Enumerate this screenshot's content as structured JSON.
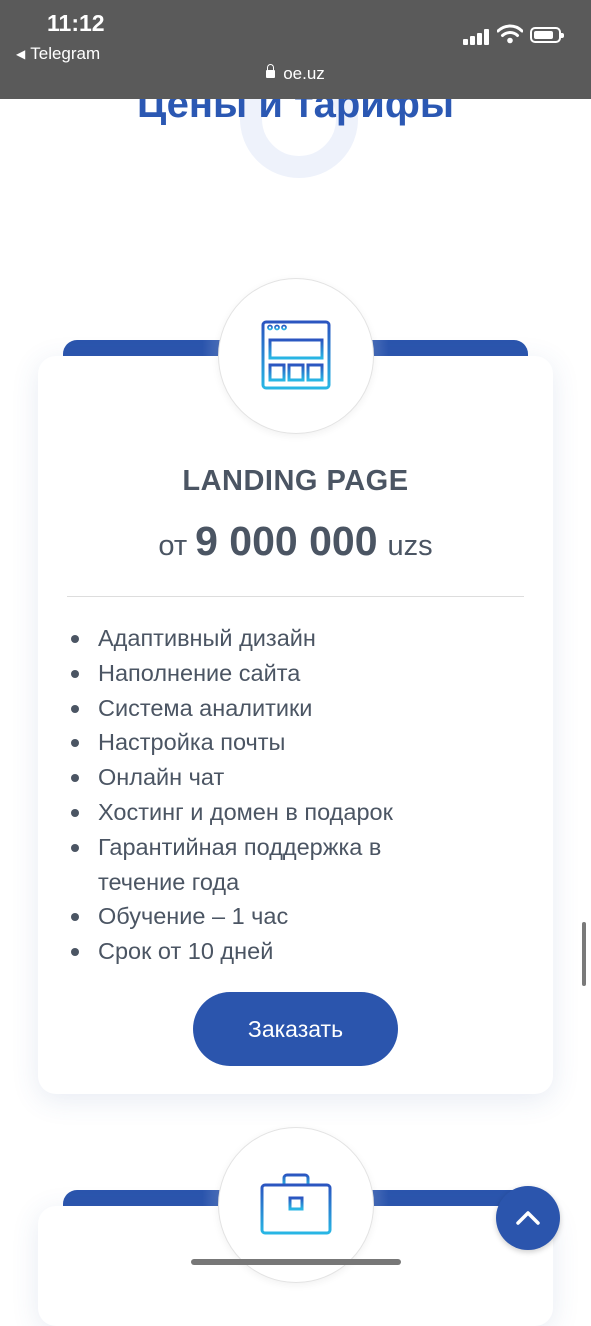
{
  "status_bar": {
    "time": "11:12",
    "back_app": "Telegram",
    "url": "oe.uz"
  },
  "page": {
    "heading": "Цены и тарифы"
  },
  "plan": {
    "icon": "browser-window-icon",
    "title": "LANDING PAGE",
    "price_prefix": "от",
    "price_amount": "9 000 000",
    "price_currency": "uzs",
    "features": [
      "Адаптивный дизайн",
      "Наполнение сайта",
      "Система аналитики",
      "Настройка почты",
      "Онлайн чат",
      "Хостинг и домен в подарок",
      "Гарантийная поддержка в течение года",
      "Обучение – 1 час",
      "Срок от 10 дней"
    ],
    "order_label": "Заказать"
  },
  "next_plan": {
    "icon": "briefcase-icon"
  },
  "colors": {
    "accent": "#2b55ad",
    "text": "#4b5563",
    "topbar": "#5a5a5a"
  }
}
